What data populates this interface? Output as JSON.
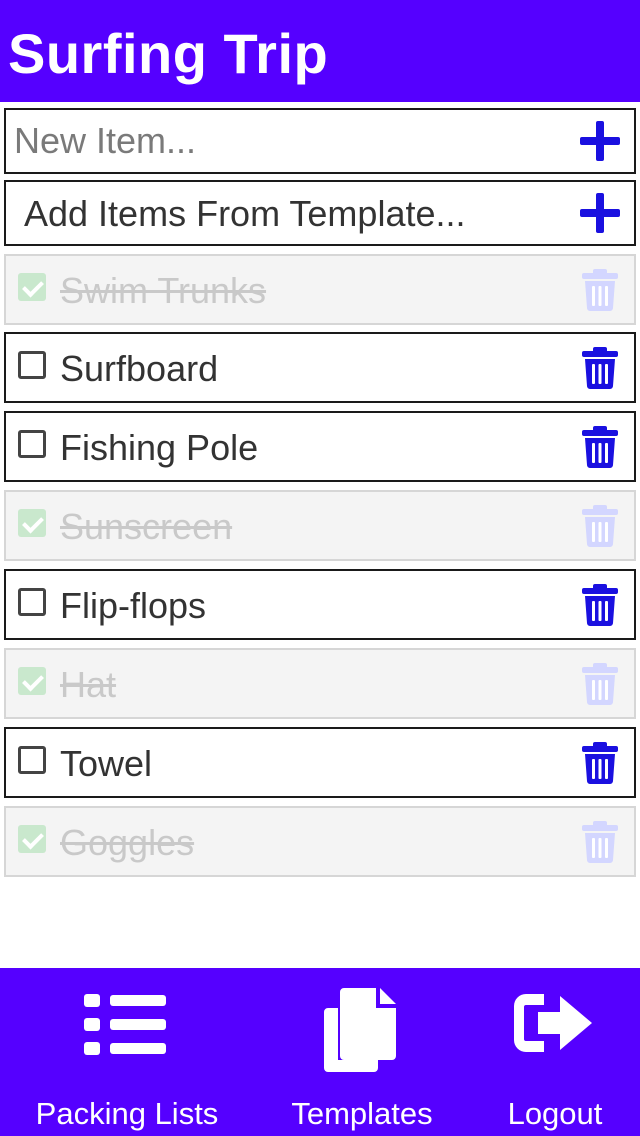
{
  "header": {
    "title": "Surfing Trip"
  },
  "new_item": {
    "placeholder": "New Item..."
  },
  "template_row": {
    "label": "Add Items From Template..."
  },
  "items": [
    {
      "label": "Swim Trunks",
      "checked": true
    },
    {
      "label": "Surfboard",
      "checked": false
    },
    {
      "label": "Fishing Pole",
      "checked": false
    },
    {
      "label": "Sunscreen",
      "checked": true
    },
    {
      "label": "Flip-flops",
      "checked": false
    },
    {
      "label": "Hat",
      "checked": true
    },
    {
      "label": "Towel",
      "checked": false
    },
    {
      "label": "Goggles",
      "checked": true
    }
  ],
  "footer": {
    "packing_lists": "Packing Lists",
    "templates": "Templates",
    "logout": "Logout"
  },
  "colors": {
    "brand": "#5500ff",
    "accent": "#1a10e0",
    "accent_disabled": "#d3d6ff",
    "check_done": "#c9e8cd"
  },
  "icons": {
    "add": "plus-icon",
    "delete": "trash-icon",
    "lists": "list-icon",
    "templates": "copy-icon",
    "logout": "sign-out-icon"
  }
}
